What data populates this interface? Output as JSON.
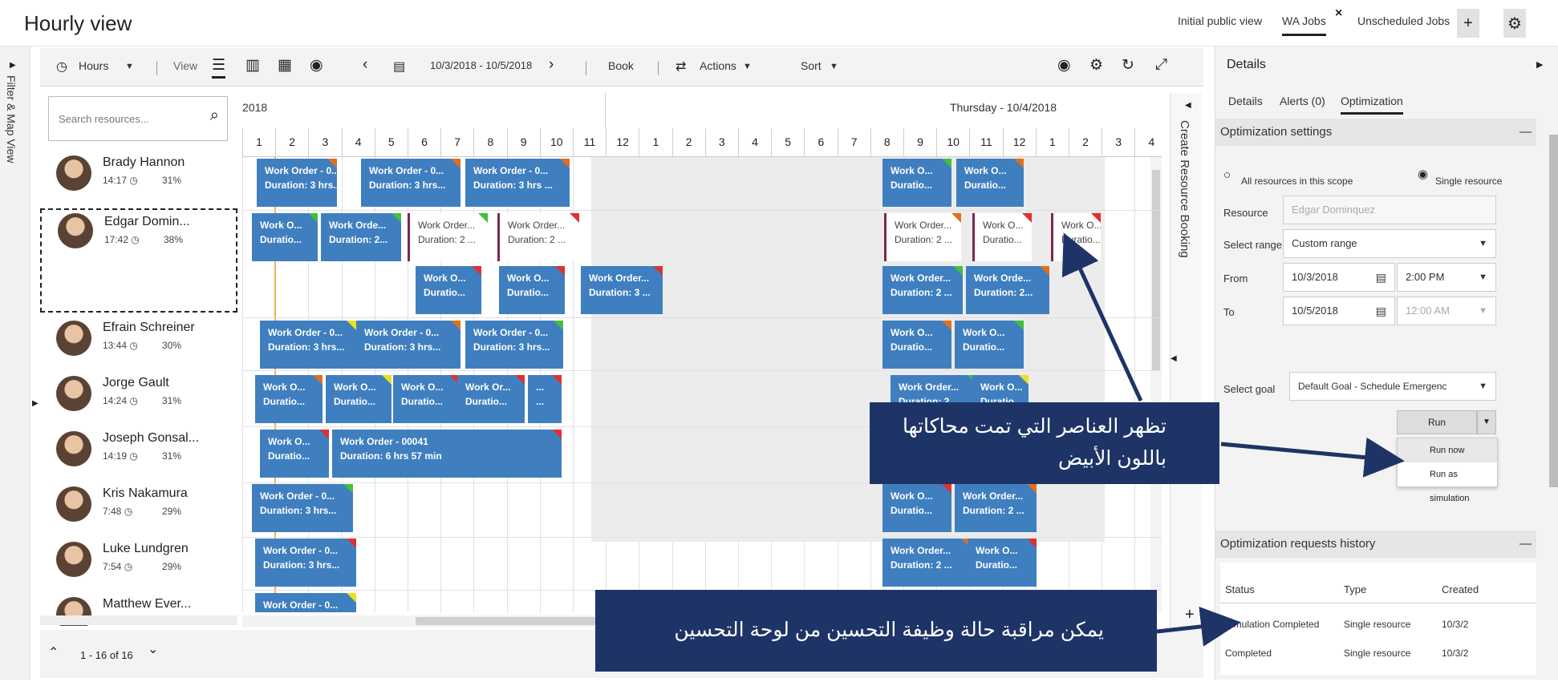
{
  "app": {
    "title": "Hourly view"
  },
  "top_tabs": [
    {
      "label": "Initial public view"
    },
    {
      "label": "WA Jobs"
    },
    {
      "label": "Unscheduled Jobs"
    }
  ],
  "side_label": "Filter & Map View",
  "toolbar": {
    "hours": "Hours",
    "view": "View",
    "date_range": "10/3/2018 - 10/5/2018",
    "book": "Book",
    "actions": "Actions",
    "sort": "Sort"
  },
  "search": {
    "placeholder": "Search resources..."
  },
  "grid": {
    "date_left": "2018",
    "date_right": "Thursday - 10/4/2018",
    "hours": [
      "1",
      "2",
      "3",
      "4",
      "5",
      "6",
      "7",
      "8",
      "9",
      "10",
      "11",
      "12",
      "1",
      "2",
      "3",
      "4",
      "5",
      "6",
      "7",
      "8",
      "9",
      "10",
      "11",
      "12",
      "1",
      "2",
      "3",
      "4"
    ]
  },
  "resources": [
    {
      "name": "Brady Hannon",
      "time": "14:17",
      "util": "31%"
    },
    {
      "name": "Edgar Domin...",
      "time": "17:42",
      "util": "38%"
    },
    {
      "name": "Efrain Schreiner",
      "time": "13:44",
      "util": "30%"
    },
    {
      "name": "Jorge Gault",
      "time": "14:24",
      "util": "31%"
    },
    {
      "name": "Joseph Gonsal...",
      "time": "14:19",
      "util": "31%"
    },
    {
      "name": "Kris Nakamura",
      "time": "7:48",
      "util": "29%"
    },
    {
      "name": "Luke Lundgren",
      "time": "7:54",
      "util": "29%"
    },
    {
      "name": "Matthew Ever...",
      "time": "",
      "util": ""
    }
  ],
  "bookings": [
    {
      "l1": "Work Order - 0...",
      "l2": "Duration: 3 hrs...",
      "tc": "#e07020"
    },
    {
      "l1": "Work Order - 0...",
      "l2": "Duration: 3 hrs...",
      "tc": "#e07020"
    },
    {
      "l1": "Work Order - 0...",
      "l2": "Duration: 3 hrs ...",
      "tc": "#e07020"
    },
    {
      "l1": "Work O...",
      "l2": "Duratio...",
      "tc": "#40c040"
    },
    {
      "l1": "Work O...",
      "l2": "Duratio...",
      "tc": "#e07020"
    },
    {
      "l1": "Work O...",
      "l2": "Duratio...",
      "tc": "#40c040"
    },
    {
      "l1": "Work Orde...",
      "l2": "Duration: 2...",
      "tc": "#40c040"
    },
    {
      "l1": "Work Order...",
      "l2": "Duration: 2 ...",
      "tc": "#40c040"
    },
    {
      "l1": "Work Order...",
      "l2": "Duration: 2 ...",
      "tc": "#e03030"
    },
    {
      "l1": "Work Order...",
      "l2": "Duration: 2 ...",
      "tc": "#e07020"
    },
    {
      "l1": "Work O...",
      "l2": "Duratio...",
      "tc": "#e03030"
    },
    {
      "l1": "Work O...",
      "l2": "Duratio...",
      "tc": "#e03030"
    },
    {
      "l1": "Work O...",
      "l2": "Duratio...",
      "tc": "#e03030"
    },
    {
      "l1": "Work O...",
      "l2": "Duratio...",
      "tc": "#e03030"
    },
    {
      "l1": "Work Order...",
      "l2": "Duration: 3 ...",
      "tc": "#e03030"
    },
    {
      "l1": "Work Order...",
      "l2": "Duration: 2 ...",
      "tc": "#40c040"
    },
    {
      "l1": "Work Orde...",
      "l2": "Duration: 2...",
      "tc": "#e07020"
    },
    {
      "l1": "Work Order - 0...",
      "l2": "Duration: 3 hrs...",
      "tc": "#e8e020"
    },
    {
      "l1": "Work Order - 0...",
      "l2": "Duration: 3 hrs...",
      "tc": "#e07020"
    },
    {
      "l1": "Work Order - 0...",
      "l2": "Duration: 3 hrs...",
      "tc": "#40c040"
    },
    {
      "l1": "Work O...",
      "l2": "Duratio...",
      "tc": "#e07020"
    },
    {
      "l1": "Work O...",
      "l2": "Duratio...",
      "tc": "#40c040"
    },
    {
      "l1": "Work O...",
      "l2": "Duratio...",
      "tc": "#e07020"
    },
    {
      "l1": "Work O...",
      "l2": "Duratio...",
      "tc": "#e8e020"
    },
    {
      "l1": "Work O...",
      "l2": "Duratio...",
      "tc": "#e03030"
    },
    {
      "l1": "Work Or...",
      "l2": "Duratio...",
      "tc": "#e03030"
    },
    {
      "l1": "...",
      "l2": "...",
      "tc": "#e03030"
    },
    {
      "l1": "Work Order...",
      "l2": "Duration: 2 ...",
      "tc": "#40c040"
    },
    {
      "l1": "Work O...",
      "l2": "Duratio...",
      "tc": "#e8e020"
    },
    {
      "l1": "Work O...",
      "l2": "Duratio...",
      "tc": "#e03030"
    },
    {
      "l1": "Work Order - 00041",
      "l2": "Duration: 6 hrs 57 min",
      "tc": "#e03030"
    },
    {
      "l1": "Work Order - 0...",
      "l2": "Duration: 3 hrs...",
      "tc": "#40c040"
    },
    {
      "l1": "Work O...",
      "l2": "Duratio...",
      "tc": "#e03030"
    },
    {
      "l1": "Work Order...",
      "l2": "Duration: 2 ...",
      "tc": "#e07020"
    },
    {
      "l1": "Work Order - 0...",
      "l2": "Duration: 3 hrs...",
      "tc": "#e03030"
    },
    {
      "l1": "Work Order...",
      "l2": "Duration: 2 ...",
      "tc": "#e07020"
    },
    {
      "l1": "Work O...",
      "l2": "Duratio...",
      "tc": "#e03030"
    },
    {
      "l1": "Work Order - 0...",
      "l2": "",
      "tc": "#e8e020"
    }
  ],
  "create_booking": "Create Resource Booking",
  "pager": "1 - 16 of 16",
  "details": {
    "title": "Details",
    "tabs": [
      "Details",
      "Alerts (0)",
      "Optimization"
    ],
    "opt_settings": "Optimization settings",
    "scope_all": "All resources in this scope",
    "scope_single": "Single resource",
    "resource_label": "Resource",
    "resource_value": "Edgar Dominquez",
    "range_label": "Select range",
    "range_value": "Custom range",
    "from_label": "From",
    "from_date": "10/3/2018",
    "from_time": "2:00 PM",
    "to_label": "To",
    "to_date": "10/5/2018",
    "to_time": "12:00 AM",
    "goal_label": "Select goal",
    "goal_value": "Default Goal - Schedule Emergenc",
    "run": "Run",
    "run_now": "Run now",
    "run_sim": "Run as simulation",
    "history": "Optimization requests history",
    "col_status": "Status",
    "col_type": "Type",
    "col_created": "Created",
    "rows": [
      {
        "status": "Simulation Completed",
        "type": "Single resource",
        "created": "10/3/2"
      },
      {
        "status": "Completed",
        "type": "Single resource",
        "created": "10/3/2"
      }
    ]
  },
  "callouts": {
    "top": "تظهر العناصر التي تمت محاكاتها باللون الأبيض",
    "bottom": "يمكن مراقبة حالة وظيفة التحسين من لوحة التحسين"
  }
}
